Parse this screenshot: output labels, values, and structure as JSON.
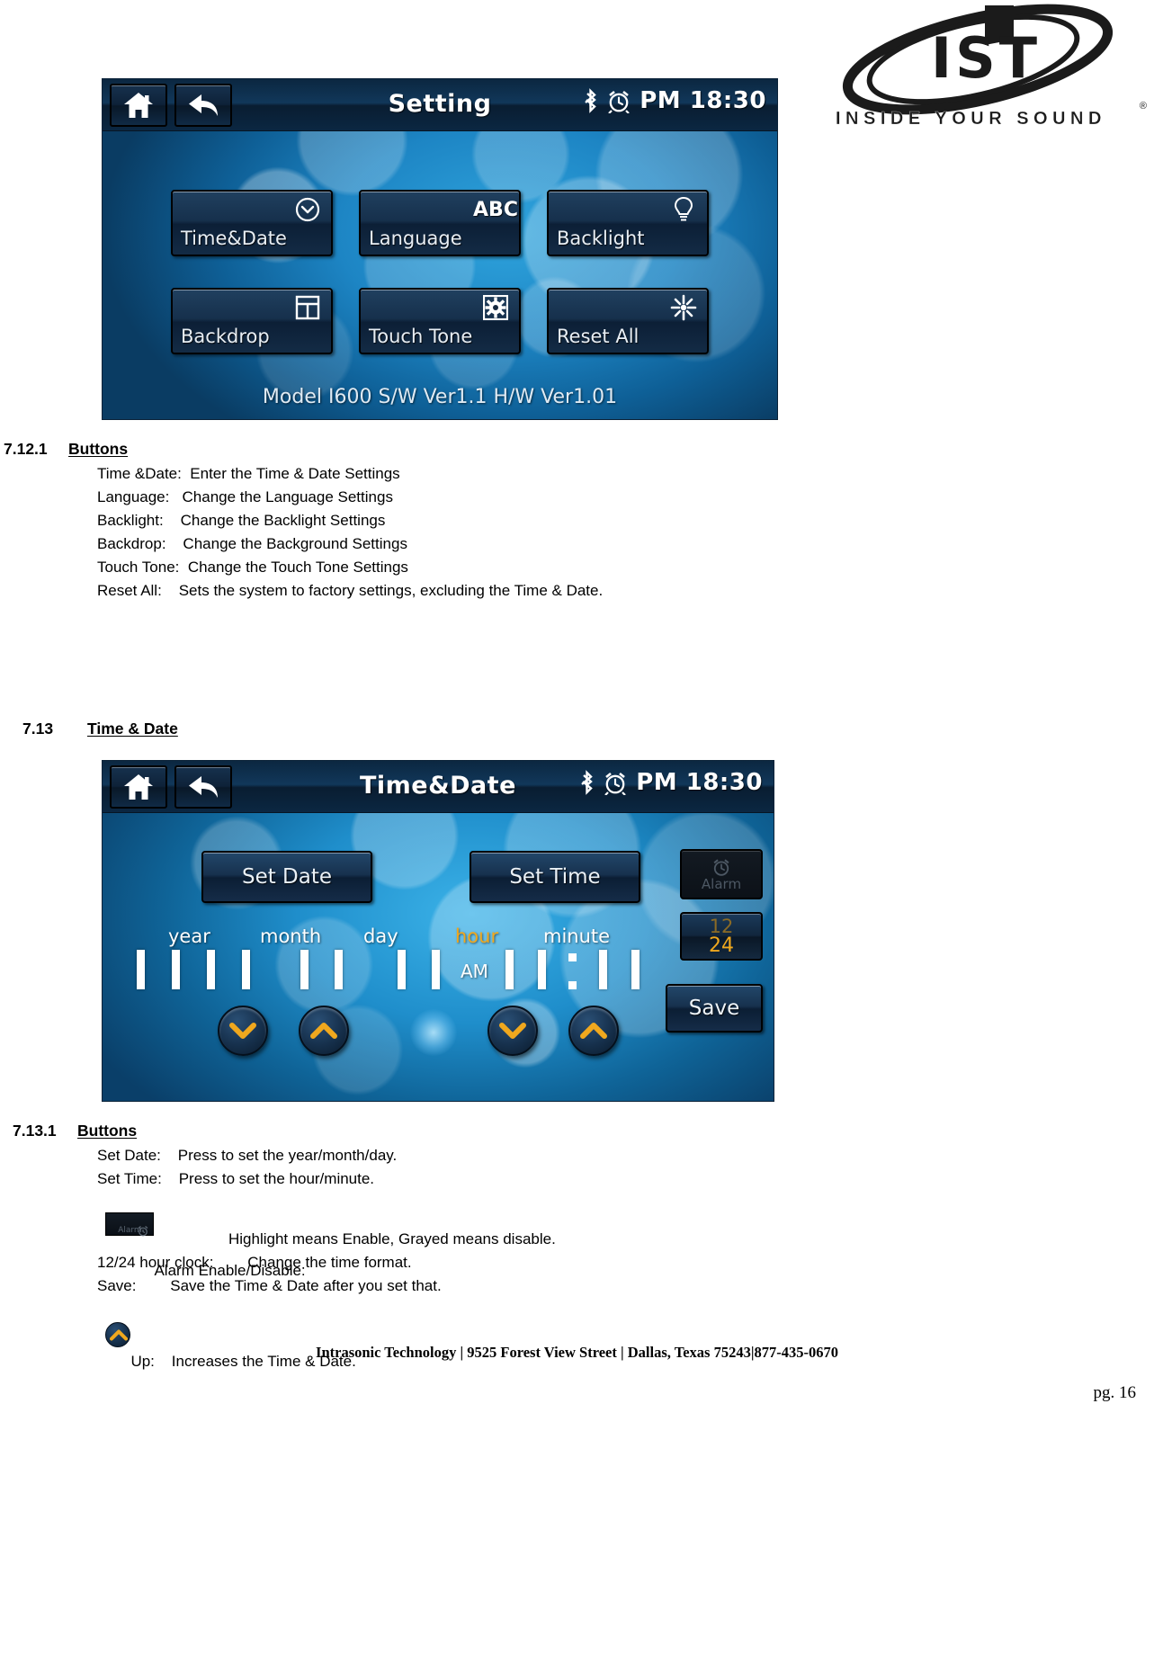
{
  "logo": {
    "mark_text": "IST",
    "tagline": "INSIDE YOUR SOUND",
    "registered": "®"
  },
  "screenshot_setting": {
    "header": {
      "title": "Setting",
      "home_icon": "home-icon",
      "back_icon": "back-arrow-icon",
      "bluetooth_icon": "bluetooth-icon",
      "alarm_icon": "alarm-clock-icon",
      "clock": "PM 18:30"
    },
    "buttons": [
      {
        "label": "Time&Date",
        "icon": "clock-icon"
      },
      {
        "label": "Language",
        "icon": "abc-icon",
        "icon_text": "ABC"
      },
      {
        "label": "Backlight",
        "icon": "bulb-icon"
      },
      {
        "label": "Backdrop",
        "icon": "grid-window-icon"
      },
      {
        "label": "Touch Tone",
        "icon": "gear-icon"
      },
      {
        "label": "Reset All",
        "icon": "starburst-icon"
      }
    ],
    "model_line": "Model I600   S/W Ver1.1 H/W Ver1.01"
  },
  "section_7_12_1": {
    "number": "7.12.1",
    "title": "Buttons",
    "lines": [
      "Time &Date:  Enter the Time & Date Settings",
      "Language:   Change the Language Settings",
      "Backlight:    Change the Backlight Settings",
      "Backdrop:    Change the Background Settings",
      "Touch Tone:  Change the Touch Tone Settings",
      "Reset All:    Sets the system to factory settings, excluding the Time & Date."
    ]
  },
  "section_7_13": {
    "number": "7.13",
    "title": "Time & Date"
  },
  "screenshot_timedate": {
    "header": {
      "title": "Time&Date",
      "home_icon": "home-icon",
      "back_icon": "back-arrow-icon",
      "bluetooth_icon": "bluetooth-icon",
      "alarm_icon": "alarm-clock-icon",
      "clock": "PM 18:30"
    },
    "set_date_label": "Set Date",
    "set_time_label": "Set Time",
    "alarm_label": "Alarm",
    "toggle_12": "12",
    "toggle_24": "24",
    "save_label": "Save",
    "field_labels": {
      "year": "year",
      "month": "month",
      "day": "day",
      "hour": "hour",
      "minute": "minute"
    },
    "active_field": "hour",
    "active_color": "#f0a81e",
    "meridiem": "AM",
    "digit_counts": {
      "year": 4,
      "month": 2,
      "day": 2,
      "hour": 2,
      "minute": 2
    },
    "arrow_buttons": [
      {
        "name": "date-down-arrow",
        "icon": "chevron-down-icon"
      },
      {
        "name": "date-up-arrow",
        "icon": "chevron-up-icon"
      },
      {
        "name": "time-down-arrow",
        "icon": "chevron-down-icon"
      },
      {
        "name": "time-up-arrow",
        "icon": "chevron-up-icon"
      }
    ]
  },
  "section_7_13_1": {
    "number": "7.13.1",
    "title": "Buttons",
    "lines": [
      "Set Date:    Press to set the year/month/day.",
      "Set Time:    Press to set the hour/minute."
    ],
    "alarm_line": "Alarm Enable/Disable:",
    "alarm_sub": "Highlight means Enable, Grayed means disable.",
    "lines2": [
      "12/24 hour clock:        Change the time format.",
      "Save:        Save the Time & Date after you set that."
    ],
    "up_line": "Up:    Increases the Time & Date."
  },
  "footer": {
    "text": "Intrasonic Technology | 9525 Forest View Street | Dallas, Texas 75243|877-435-0670",
    "page": "pg. 16"
  }
}
